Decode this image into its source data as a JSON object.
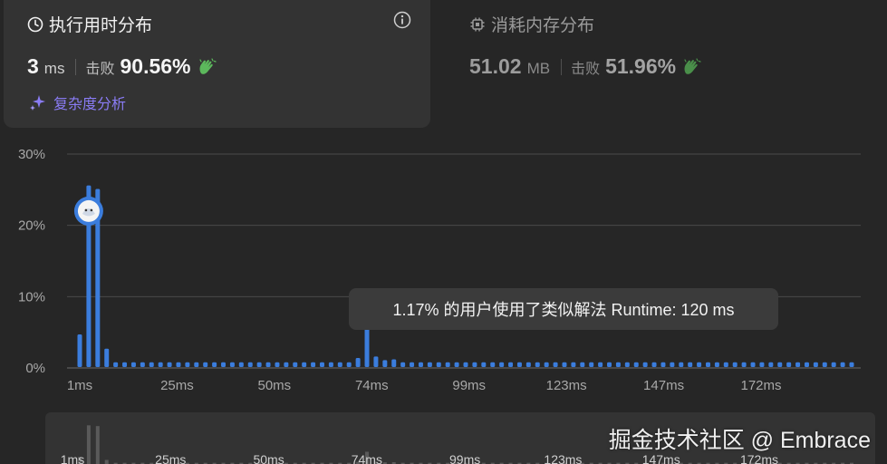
{
  "runtime_card": {
    "title": "执行用时分布",
    "value": "3",
    "unit": "ms",
    "beat_label": "击败",
    "beat_percent": "90.56%",
    "complexity_link": "复杂度分析"
  },
  "memory_card": {
    "title": "消耗内存分布",
    "value": "51.02",
    "unit": "MB",
    "beat_label": "击败",
    "beat_percent": "51.96%"
  },
  "tooltip": {
    "text": "1.17% 的用户使用了类似解法 Runtime: 120 ms"
  },
  "colors": {
    "bar": "#3b7ddd",
    "accent": "#8a7cf5",
    "clap": "#5cb85c"
  },
  "chart_data": {
    "type": "bar",
    "y_ticks": [
      "30%",
      "20%",
      "10%",
      "0%"
    ],
    "ylim": [
      0,
      30
    ],
    "x_tick_labels": [
      "1ms",
      "25ms",
      "50ms",
      "74ms",
      "99ms",
      "123ms",
      "147ms",
      "172ms"
    ],
    "values": [
      4.7,
      25.6,
      25.1,
      2.7,
      0.8,
      0.8,
      0.8,
      0.8,
      0.8,
      0.8,
      0.8,
      0.8,
      0.8,
      0.8,
      0.8,
      0.8,
      0.8,
      0.8,
      0.8,
      0.8,
      0.8,
      0.8,
      0.8,
      0.8,
      0.8,
      0.8,
      0.8,
      0.8,
      0.8,
      0.8,
      0.8,
      1.4,
      8.1,
      1.6,
      1.1,
      1.2,
      0.8,
      0.8,
      0.8,
      0.8,
      0.8,
      0.8,
      0.8,
      0.8,
      0.8,
      0.8,
      0.8,
      0.8,
      0.8,
      0.8,
      0.8,
      0.8,
      0.8,
      0.8,
      0.8,
      0.8,
      0.8,
      0.8,
      0.8,
      0.8,
      0.8,
      0.8,
      0.8,
      0.8,
      0.8,
      0.8,
      0.8,
      0.8,
      0.8,
      0.8,
      0.8,
      0.8,
      0.8,
      0.8,
      0.8,
      0.8,
      0.8,
      0.8,
      0.8,
      0.8,
      0.8,
      0.8,
      0.8,
      0.8,
      0.8,
      0.8,
      0.8
    ],
    "selected_index": 1,
    "selected_value": 22.0,
    "grid": true
  },
  "navigator": {
    "tick_labels": [
      "1ms",
      "25ms",
      "50ms",
      "74ms",
      "99ms",
      "123ms",
      "147ms",
      "172ms"
    ]
  },
  "watermark": "掘金技术社区 @ Embrace"
}
